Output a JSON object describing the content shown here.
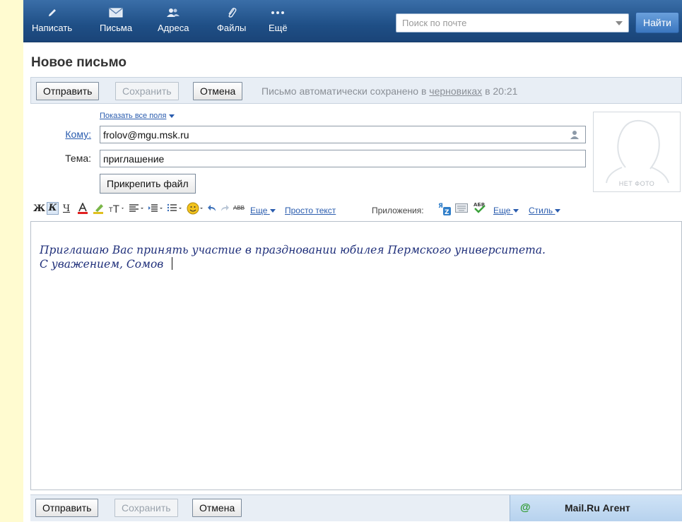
{
  "nav": [
    {
      "label": "Написать",
      "icon": "pencil-icon"
    },
    {
      "label": "Письма",
      "icon": "envelope-icon"
    },
    {
      "label": "Адреса",
      "icon": "contacts-icon"
    },
    {
      "label": "Файлы",
      "icon": "paperclip-icon"
    },
    {
      "label": "Ещё",
      "icon": "more-dots-icon"
    }
  ],
  "search": {
    "placeholder": "Поиск по почте",
    "button": "Найти"
  },
  "page": {
    "title": "Новое письмо"
  },
  "actions": {
    "send": "Отправить",
    "save": "Сохранить",
    "cancel": "Отмена",
    "saved_prefix": "Письмо автоматически сохранено в",
    "saved_link": "черновиках",
    "saved_time": "в 20:21"
  },
  "form": {
    "show_all_fields": "Показать все поля",
    "to_label": "Кому:",
    "to_value": "frolov@mgu.msk.ru",
    "subject_label": "Тема:",
    "subject_value": "приглашение",
    "attach_button": "Прикрепить файл",
    "no_photo": "НЕТ ФОТО"
  },
  "toolbar": {
    "bold": "Ж",
    "italic": "К",
    "underline": "Ч",
    "strike_sample": "ABB",
    "more": "Еще",
    "plain_text": "Просто текст",
    "apps_label": "Приложения:",
    "apps_more": "Еще",
    "style": "Стиль"
  },
  "body": {
    "line1": "Приглашаю Вас принять участие в праздновании юбилея Пермского университета.",
    "line2": "С уважением, Сомов"
  },
  "agent": {
    "label": "Mail.Ru Агент",
    "icon_char": "@"
  },
  "colors": {
    "topbar": "#1f4f86",
    "link": "#2a5cae",
    "body_text": "#1f2f7a",
    "agent_green": "#2e9a2e"
  }
}
